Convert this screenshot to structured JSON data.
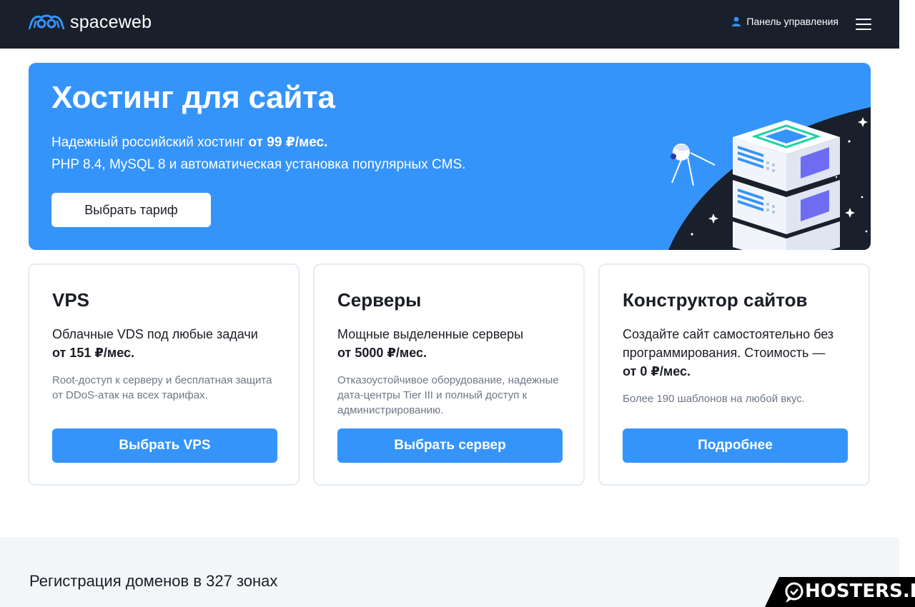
{
  "header": {
    "brand": "spaceweb",
    "panel_label": "Панель управления"
  },
  "hero": {
    "title": "Хостинг для сайта",
    "line1_text": "Надежный российский хостинг ",
    "line1_price": "от 99 ₽/мес.",
    "line2_text": "PHP 8.4, MySQL 8 и автоматическая установка популярных CMS.",
    "button_label": "Выбрать тариф"
  },
  "cards": [
    {
      "title": "VPS",
      "desc_text": "Облачные VDS под любые задачи",
      "desc_price": "от 151 ₽/мес.",
      "note": "Root-доступ к серверу и бесплатная защита от DDoS-атак на всех тарифах.",
      "button_label": "Выбрать VPS"
    },
    {
      "title": "Серверы",
      "desc_text": "Мощные выделенные серверы",
      "desc_price": "от 5000 ₽/мес.",
      "note": "Отказоустойчивое оборудование, надежные дата-центры Tier III и полный доступ к администрированию.",
      "button_label": "Выбрать сервер"
    },
    {
      "title": "Конструктор сайтов",
      "desc_text": "Создайте сайт самостоятельно без программирования. Стоимость — ",
      "desc_price": "от 0 ₽/мес.",
      "note": "Более 190 шаблонов на любой вкус.",
      "button_label": "Подробнее"
    }
  ],
  "domains": {
    "title": "Регистрация доменов в 327 зонах"
  },
  "watermark": {
    "text": "HOSTERS.RU"
  },
  "colors": {
    "header_bg": "#19202c",
    "accent": "#3594fa",
    "text": "#1a1d24",
    "muted": "#6e7784"
  }
}
